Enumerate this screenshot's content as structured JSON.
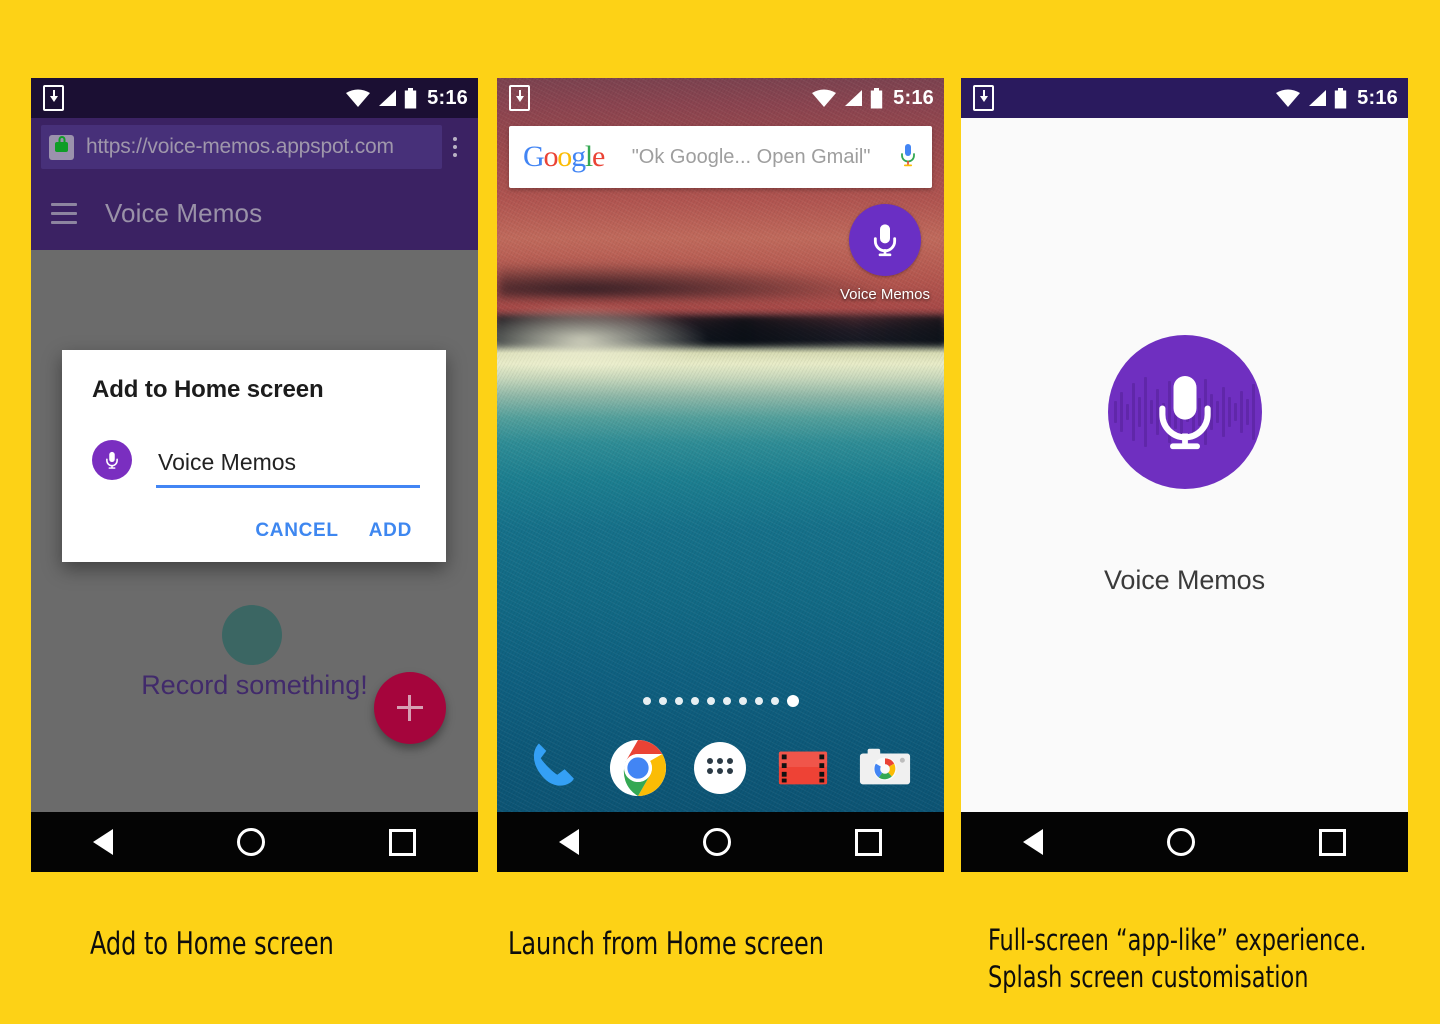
{
  "page": {
    "background_color": "#fdd216",
    "accent_purple": "#6f2fc0",
    "app_name": "Voice Memos"
  },
  "phone1": {
    "name": "add-to-home-screen-phone",
    "status_bar": {
      "time": "5:16",
      "icons": [
        "download-icon",
        "wifi-icon",
        "signal-icon",
        "battery-icon"
      ]
    },
    "browser": {
      "url": "https://voice-memos.appspot.com",
      "lock_icon": "lock-icon",
      "overflow_icon": "overflow-menu-icon"
    },
    "app_bar": {
      "menu_icon": "hamburger-icon",
      "title": "Voice Memos"
    },
    "content": {
      "empty_state_text": "Record something!",
      "fab_icon": "plus-icon"
    },
    "dialog": {
      "title": "Add to Home screen",
      "app_icon": "microphone-icon",
      "shortcut_name": "Voice Memos",
      "shortcut_placeholder": "Voice Memos",
      "cancel_label": "CANCEL",
      "add_label": "ADD"
    },
    "nav_bar": {
      "back": "back-icon",
      "home": "home-icon",
      "recents": "recents-icon"
    },
    "caption": "Add to Home screen"
  },
  "phone2": {
    "name": "home-screen-phone",
    "status_bar": {
      "time": "5:16",
      "icons": [
        "download-icon",
        "wifi-icon",
        "signal-icon",
        "battery-icon"
      ]
    },
    "search_widget": {
      "logo": "Google",
      "logo_letters": [
        "G",
        "o",
        "o",
        "g",
        "l",
        "e"
      ],
      "hint": "\"Ok Google... Open Gmail\"",
      "mic_icon": "microphone-icon"
    },
    "shortcut": {
      "icon": "microphone-icon",
      "label": "Voice Memos"
    },
    "page_indicator": {
      "count": 10,
      "active_index": 9
    },
    "dock": [
      {
        "label": "Phone",
        "icon": "phone-icon"
      },
      {
        "label": "Chrome",
        "icon": "chrome-icon"
      },
      {
        "label": "All apps",
        "icon": "app-drawer-icon"
      },
      {
        "label": "Play Movies",
        "icon": "play-movies-icon"
      },
      {
        "label": "Camera",
        "icon": "camera-icon"
      }
    ],
    "nav_bar": {
      "back": "back-icon",
      "home": "home-icon",
      "recents": "recents-icon"
    },
    "caption": "Launch from Home screen"
  },
  "phone3": {
    "name": "splash-screen-phone",
    "status_bar": {
      "time": "5:16",
      "icons": [
        "download-icon",
        "wifi-icon",
        "signal-icon",
        "battery-icon"
      ]
    },
    "splash": {
      "icon": "microphone-icon",
      "title": "Voice Memos"
    },
    "nav_bar": {
      "back": "back-icon",
      "home": "home-icon",
      "recents": "recents-icon"
    },
    "caption": "Full-screen “app-like” experience.\nSplash screen customisation"
  }
}
